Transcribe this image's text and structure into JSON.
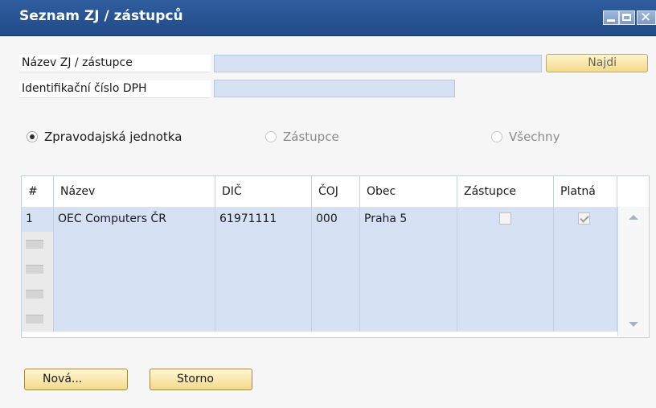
{
  "window": {
    "title": "Seznam ZJ / zástupců",
    "controls": {
      "minimize": "minimize-icon",
      "maximize": "maximize-icon",
      "close": "close-icon"
    }
  },
  "form": {
    "name_label": "Název ZJ / zástupce",
    "name_value": "",
    "vat_label": "Identifikační číslo DPH",
    "vat_value": "",
    "find_button": "Najdi"
  },
  "filter": {
    "options": [
      {
        "label": "Zpravodajská jednotka",
        "selected": true,
        "enabled": true
      },
      {
        "label": "Zástupce",
        "selected": false,
        "enabled": false
      },
      {
        "label": "Všechny",
        "selected": false,
        "enabled": false
      }
    ]
  },
  "grid": {
    "columns": [
      "#",
      "Název",
      "DIČ",
      "ČOJ",
      "Obec",
      "Zástupce",
      "Platná"
    ],
    "rows": [
      {
        "num": "1",
        "name": "OEC Computers ČR",
        "dic": "61971111",
        "coj": "000",
        "obec": "Praha 5",
        "zastupce": false,
        "platna": true
      },
      {
        "num": "",
        "name": "",
        "dic": "",
        "coj": "",
        "obec": "",
        "zastupce": null,
        "platna": null
      },
      {
        "num": "",
        "name": "",
        "dic": "",
        "coj": "",
        "obec": "",
        "zastupce": null,
        "platna": null
      },
      {
        "num": "",
        "name": "",
        "dic": "",
        "coj": "",
        "obec": "",
        "zastupce": null,
        "platna": null
      },
      {
        "num": "",
        "name": "",
        "dic": "",
        "coj": "",
        "obec": "",
        "zastupce": null,
        "platna": null
      }
    ]
  },
  "buttons": {
    "new": "Nová...",
    "cancel": "Storno"
  },
  "colors": {
    "titlebar": "#2a568f",
    "field_bg": "#d6e2f3",
    "button_bg": "#f4d98a"
  }
}
